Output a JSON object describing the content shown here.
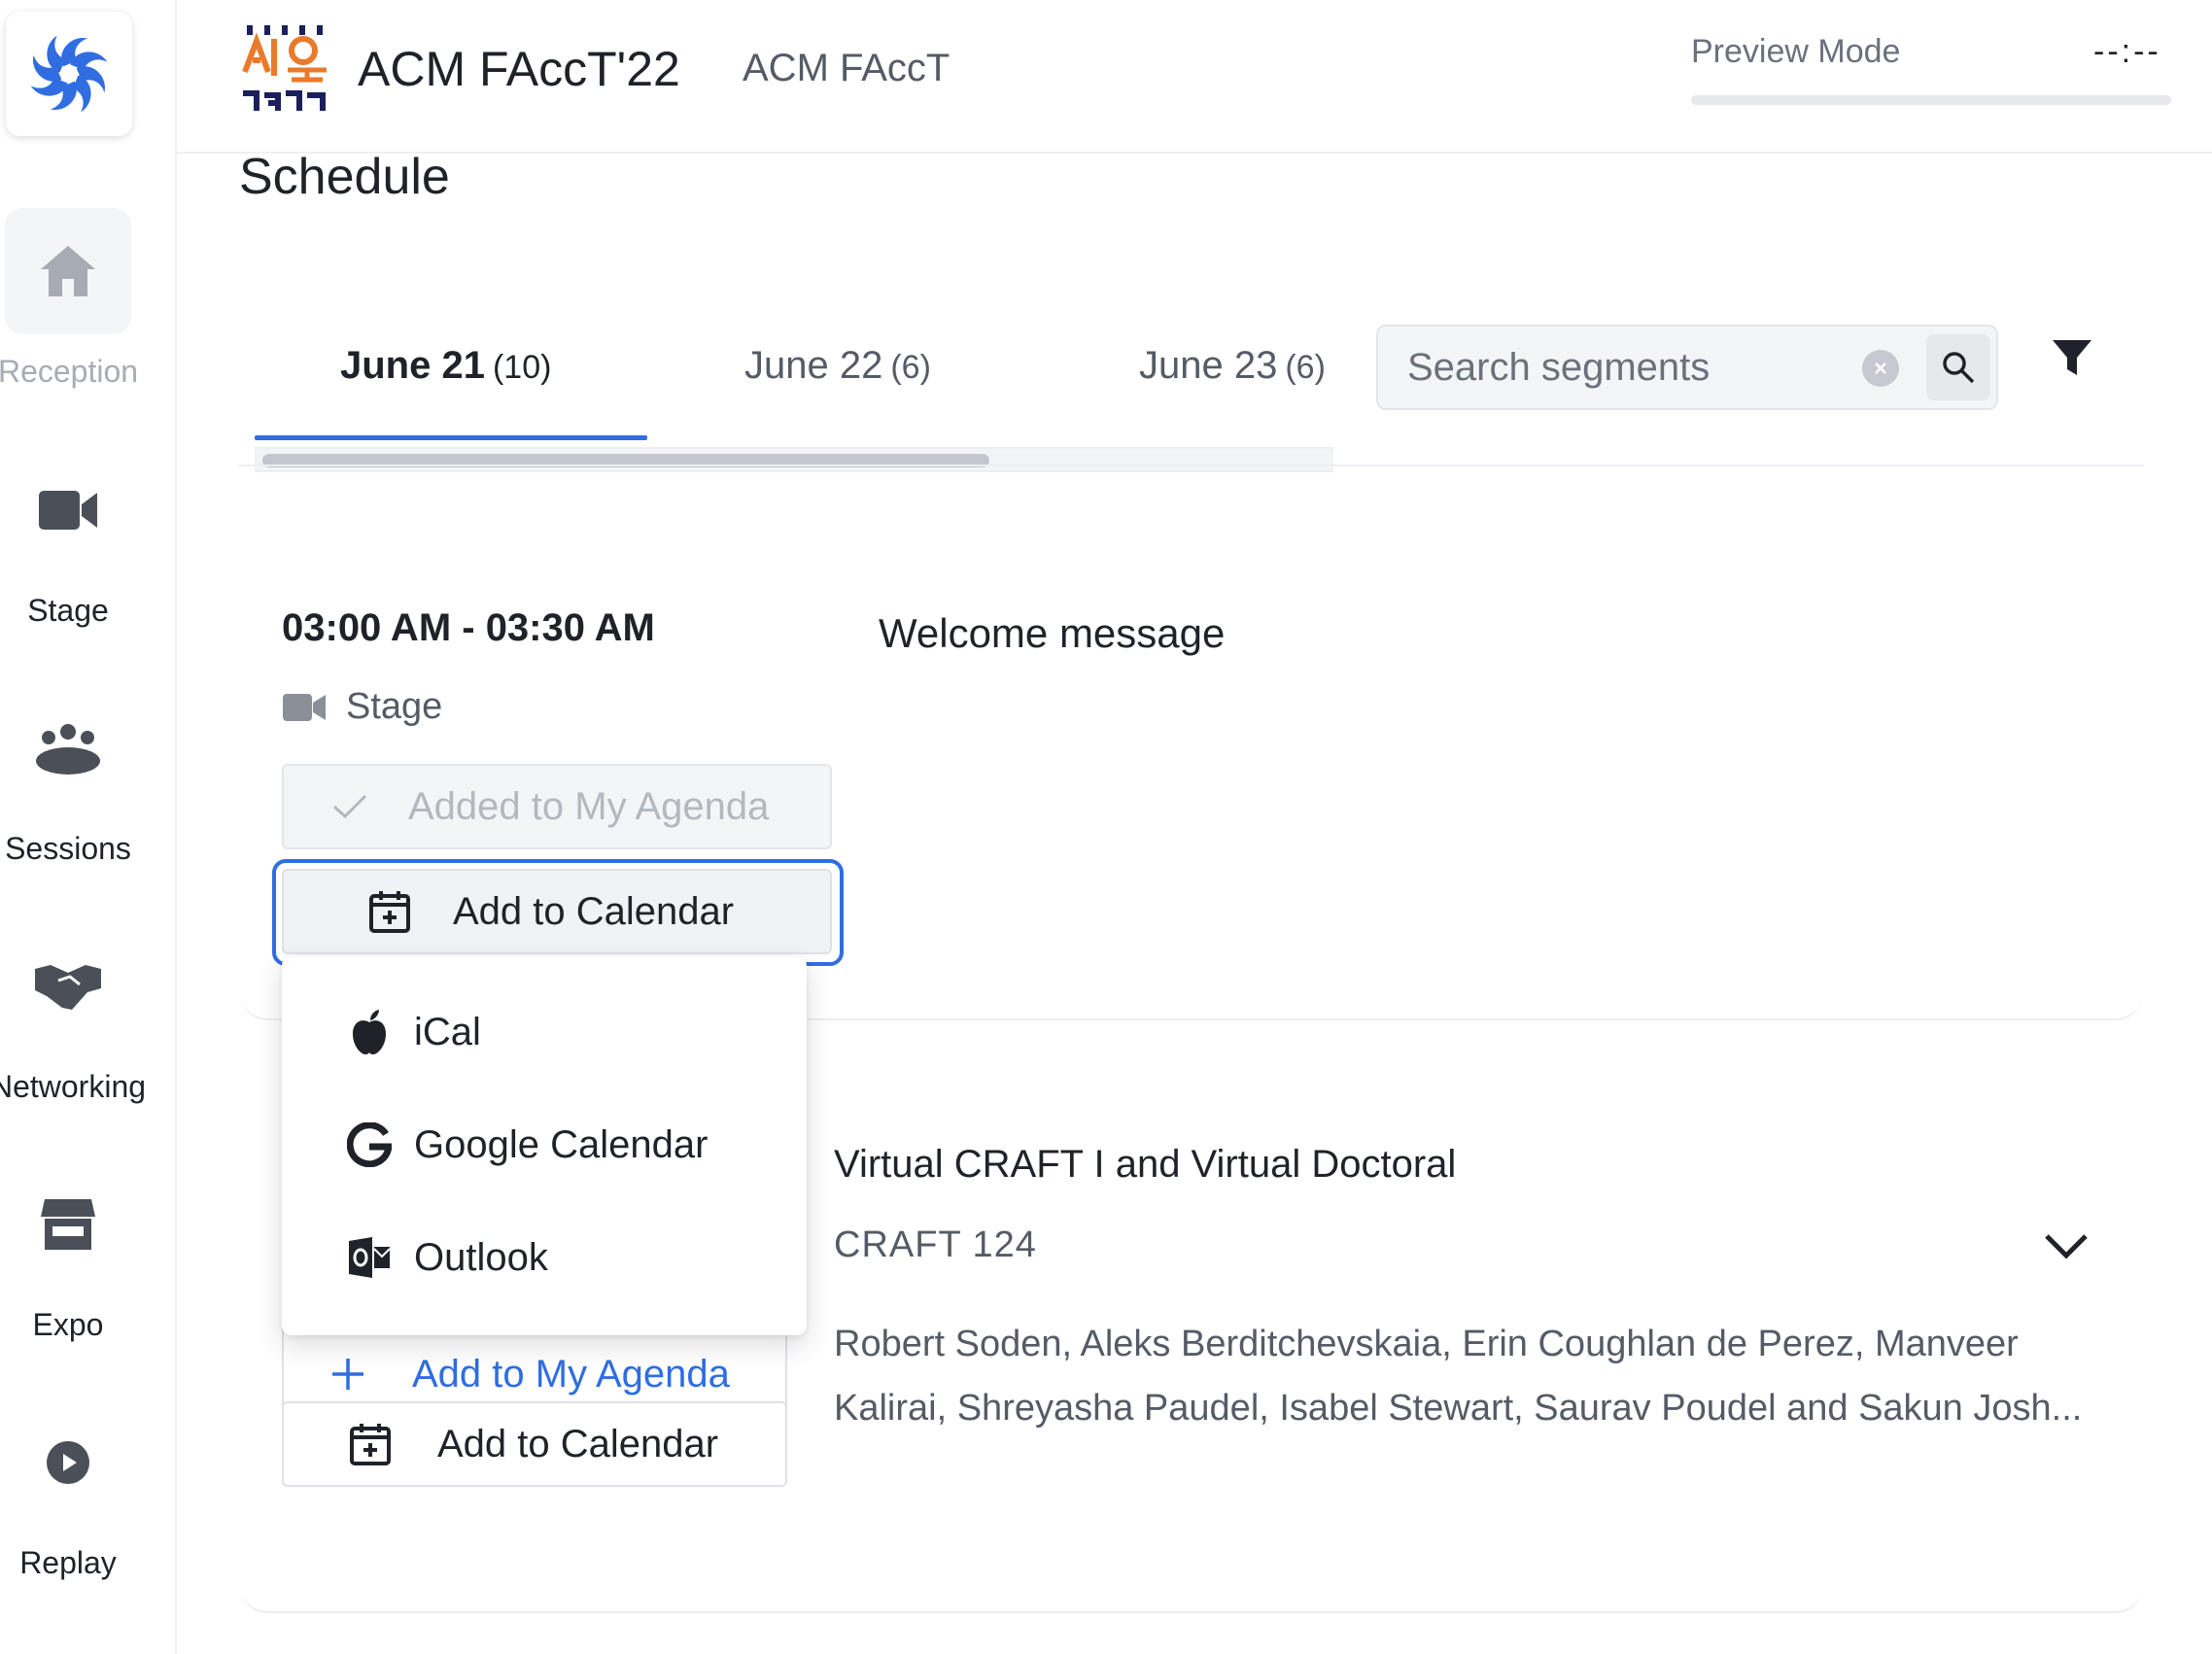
{
  "sidebar": {
    "items": [
      {
        "label": "Reception",
        "icon": "home-icon",
        "active": true
      },
      {
        "label": "Stage",
        "icon": "video-camera-icon"
      },
      {
        "label": "Sessions",
        "icon": "people-group-icon"
      },
      {
        "label": "Networking",
        "icon": "handshake-icon"
      },
      {
        "label": "Expo",
        "icon": "storefront-icon"
      },
      {
        "label": "Replay",
        "icon": "play-circle-icon"
      }
    ]
  },
  "header": {
    "event_title": "ACM FAccT'22",
    "organization": "ACM FAccT",
    "preview_label": "Preview Mode",
    "timer": "--:--",
    "progress": 0
  },
  "page": {
    "title": "Schedule"
  },
  "tabs": [
    {
      "date": "June 21",
      "count": "(10)",
      "active": true
    },
    {
      "date": "June 22",
      "count": "(6)"
    },
    {
      "date": "June 23",
      "count": "(6)"
    }
  ],
  "search": {
    "placeholder": "Search segments",
    "value": ""
  },
  "sessions": [
    {
      "time": "03:00 AM - 03:30 AM",
      "location": "Stage",
      "title": "Welcome message",
      "agenda_label": "Added to My Agenda",
      "calendar_label": "Add to Calendar"
    },
    {
      "title": "Virtual CRAFT I and Virtual Doctoral",
      "subtitle": "CRAFT 124",
      "authors": "Robert Soden, Aleks Berditchevskaia, Erin Coughlan de Perez, Manveer Kalirai, Shreyasha Paudel, Isabel Stewart, Saurav Poudel and Sakun Josh...",
      "agenda_label": "Add to My Agenda",
      "calendar_label": "Add to Calendar"
    }
  ],
  "calendar_menu": {
    "options": [
      {
        "label": "iCal",
        "icon": "apple-icon"
      },
      {
        "label": "Google Calendar",
        "icon": "google-icon"
      },
      {
        "label": "Outlook",
        "icon": "outlook-icon"
      }
    ]
  },
  "colors": {
    "accent": "#2f6de1",
    "logo_blue": "#2f6de1",
    "text": "#1f2329",
    "muted": "#555b66"
  }
}
